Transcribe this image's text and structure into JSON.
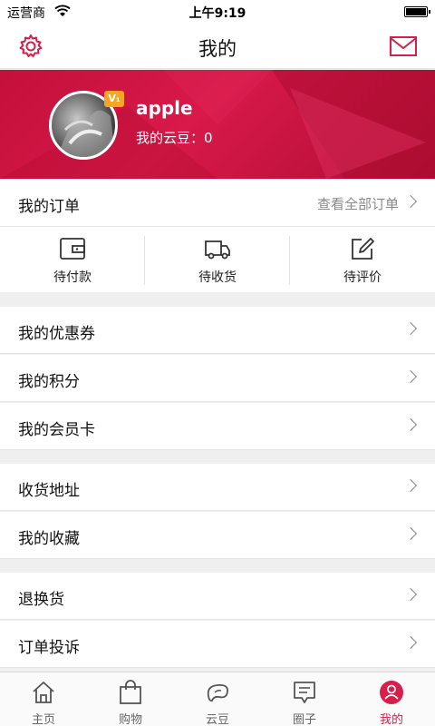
{
  "status_bar": {
    "carrier": "运营商",
    "time": "上午9:19"
  },
  "nav": {
    "title": "我的",
    "settings_icon": "gear-icon",
    "mail_icon": "mail-icon"
  },
  "profile": {
    "username": "apple",
    "badge": "V₁",
    "beans_label": "我的云豆：0"
  },
  "orders": {
    "label": "我的订单",
    "view_all": "查看全部订单",
    "actions": [
      {
        "label": "待付款",
        "icon": "wallet-icon"
      },
      {
        "label": "待收货",
        "icon": "truck-icon"
      },
      {
        "label": "待评价",
        "icon": "edit-icon"
      }
    ]
  },
  "menu_group_1": [
    {
      "label": "我的优惠券"
    },
    {
      "label": "我的积分"
    },
    {
      "label": "我的会员卡"
    }
  ],
  "menu_group_2": [
    {
      "label": "收货地址"
    },
    {
      "label": "我的收藏"
    }
  ],
  "menu_group_3": [
    {
      "label": "退换货"
    },
    {
      "label": "订单投诉"
    }
  ],
  "tabs": [
    {
      "label": "主页",
      "icon": "home-icon"
    },
    {
      "label": "购物",
      "icon": "shopping-bag-icon"
    },
    {
      "label": "云豆",
      "icon": "bean-icon"
    },
    {
      "label": "圈子",
      "icon": "chat-icon"
    },
    {
      "label": "我的",
      "icon": "user-icon",
      "active": true
    }
  ],
  "colors": {
    "accent": "#d81e4b",
    "banner": "#c4103a"
  }
}
